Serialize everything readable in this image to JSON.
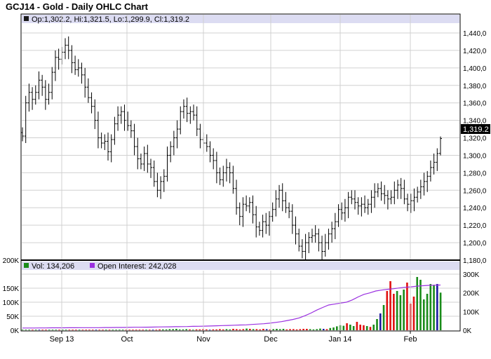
{
  "title": "GCJ14 - Gold - Daily OHLC Chart",
  "price_panel": {
    "ohlc_label": "Op:1,302.2, Hi:1,321.5, Lo:1,299.9, Cl:1,319.2",
    "last_price_label": "1,319.2",
    "y_ticks": [
      "1,440,0",
      "1,420,0",
      "1,400,0",
      "1,380,0",
      "1,360,0",
      "1,340,0",
      "1,320,0",
      "1,300,0",
      "1,280,0",
      "1,260,0",
      "1,240,0",
      "1,220,0",
      "1,200,0",
      "1,180,0"
    ]
  },
  "volume_panel": {
    "vol_label": "Vol: 134,206",
    "oi_label": "Open Interest: 242,028",
    "left_ticks": [
      "200K",
      "150K",
      "100K",
      "50K",
      "0K"
    ],
    "right_ticks": [
      "300K",
      "200K",
      "100K",
      "0K"
    ]
  },
  "x_ticks": [
    "Sep 13",
    "Oct",
    "Nov",
    "Dec",
    "Jan 14",
    "Feb"
  ],
  "colors": {
    "header_band": "#dcdcf2",
    "up_volume": "#1a8c1a",
    "down_volume": "#e01010",
    "neutral_volume": "#1a1aa0",
    "open_interest": "#9a30e0",
    "grid": "#d0d0d0"
  },
  "chart_data": [
    {
      "type": "ohlc",
      "title": "GCJ14 - Gold - Daily OHLC Chart",
      "ylim": [
        1180,
        1440
      ],
      "x_categories": [
        "Sep 13",
        "Oct",
        "Nov",
        "Dec",
        "Jan 14",
        "Feb"
      ],
      "close": [
        1322,
        1360,
        1372,
        1364,
        1372,
        1386,
        1378,
        1364,
        1372,
        1395,
        1412,
        1410,
        1418,
        1426,
        1420,
        1406,
        1398,
        1400,
        1392,
        1378,
        1366,
        1356,
        1340,
        1320,
        1314,
        1316,
        1304,
        1318,
        1336,
        1346,
        1350,
        1340,
        1334,
        1328,
        1310,
        1296,
        1290,
        1302,
        1290,
        1286,
        1270,
        1260,
        1270,
        1276,
        1300,
        1310,
        1320,
        1330,
        1350,
        1356,
        1348,
        1350,
        1346,
        1330,
        1318,
        1314,
        1310,
        1300,
        1294,
        1280,
        1272,
        1280,
        1286,
        1280,
        1262,
        1240,
        1230,
        1244,
        1242,
        1246,
        1232,
        1218,
        1214,
        1224,
        1220,
        1230,
        1238,
        1250,
        1260,
        1248,
        1240,
        1236,
        1220,
        1210,
        1196,
        1190,
        1200,
        1206,
        1208,
        1210,
        1200,
        1190,
        1200,
        1210,
        1216,
        1224,
        1238,
        1234,
        1240,
        1252,
        1250,
        1246,
        1242,
        1244,
        1240,
        1244,
        1252,
        1258,
        1262,
        1256,
        1254,
        1250,
        1252,
        1260,
        1266,
        1262,
        1250,
        1244,
        1248,
        1252,
        1258,
        1264,
        1270,
        1276,
        1286,
        1292,
        1302,
        1319.2
      ],
      "last_bar": {
        "open": 1302.2,
        "high": 1321.5,
        "low": 1299.9,
        "close": 1319.2
      }
    },
    {
      "type": "bar",
      "title": "Volume",
      "ylim": [
        0,
        200000
      ],
      "series": [
        {
          "name": "Vol",
          "values": [
            2000,
            2000,
            2000,
            2000,
            2000,
            2000,
            2000,
            2000,
            2000,
            2000,
            2000,
            2000,
            2000,
            2000,
            2000,
            2000,
            2000,
            2000,
            2000,
            2000,
            2000,
            2000,
            2000,
            2000,
            2000,
            2000,
            2000,
            2000,
            2000,
            2000,
            2000,
            2000,
            2000,
            2000,
            2000,
            2000,
            2000,
            2000,
            2000,
            2000,
            2000,
            3000,
            3000,
            3000,
            4000,
            4000,
            5000,
            3000,
            3000,
            4000,
            3000,
            2000,
            3000,
            3000,
            4000,
            3000,
            2000,
            3000,
            3000,
            4000,
            3000,
            4000,
            3000,
            5000,
            4000,
            3000,
            4000,
            6000,
            5000,
            4000,
            4000,
            3000,
            5000,
            4000,
            3000,
            4000,
            5000,
            4000,
            5000,
            3000,
            4000,
            4000,
            3000,
            4000,
            5000,
            5000,
            4000,
            3000,
            4000,
            6000,
            5000,
            4000,
            8000,
            10000,
            14000,
            18000,
            16000,
            25000,
            20000,
            15000,
            30000,
            20000,
            18000,
            15000,
            12000,
            20000,
            40000,
            60000,
            90000,
            140000,
            175000,
            130000,
            140000,
            125000,
            145000,
            170000,
            95000,
            120000,
            190000,
            180000,
            110000,
            130000,
            165000,
            160000,
            165000,
            134206
          ]
        }
      ]
    },
    {
      "type": "line",
      "title": "Open Interest",
      "ylim": [
        0,
        300000
      ],
      "series": [
        {
          "name": "Open Interest",
          "values": [
            12000,
            12000,
            12000,
            12500,
            12500,
            13000,
            13000,
            13000,
            13500,
            13500,
            14000,
            14000,
            14000,
            14000,
            14500,
            14500,
            15000,
            15000,
            15500,
            16000,
            16000,
            16500,
            17000,
            17500,
            18000,
            18500,
            19000,
            19500,
            20000,
            21000,
            21500,
            22000,
            23000,
            24000,
            25000,
            26000,
            27000,
            28000,
            29000,
            31000,
            33000,
            35000,
            38000,
            42000,
            46000,
            52000,
            58000,
            66000,
            78000,
            92000,
            108000,
            122000,
            135000,
            140000,
            145000,
            150000,
            162000,
            178000,
            192000,
            200000,
            210000,
            215000,
            219000,
            222000,
            226000,
            230000,
            232000,
            236000,
            238000,
            240000,
            241000,
            242028
          ]
        }
      ]
    }
  ]
}
